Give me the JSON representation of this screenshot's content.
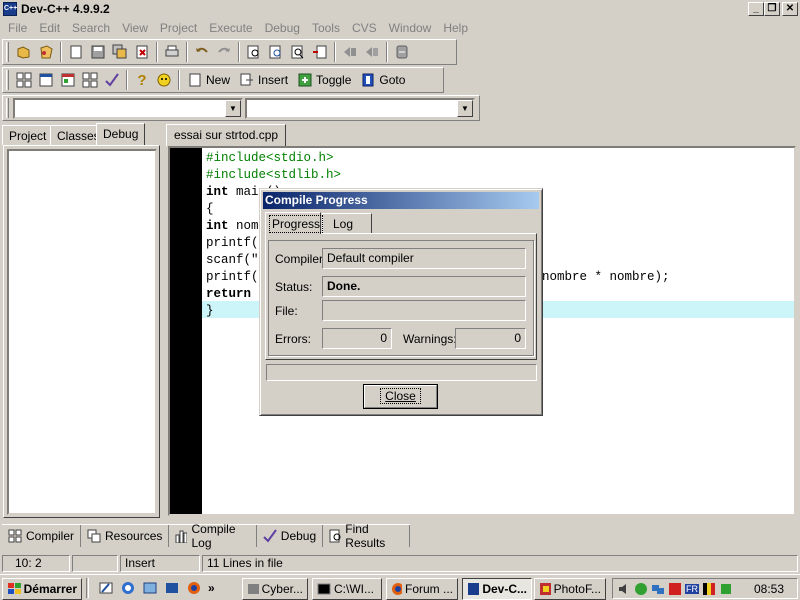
{
  "window": {
    "title": "Dev-C++ 4.9.9.2",
    "minimize": "_",
    "restore": "❐",
    "close": "✕"
  },
  "menu": [
    "File",
    "Edit",
    "Search",
    "View",
    "Project",
    "Execute",
    "Debug",
    "Tools",
    "CVS",
    "Window",
    "Help"
  ],
  "toolbar2": {
    "new": "New",
    "insert": "Insert",
    "toggle": "Toggle",
    "goto": "Goto"
  },
  "left_tabs": [
    "Project",
    "Classes",
    "Debug"
  ],
  "editor_tab": "essai sur strtod.cpp",
  "code_lines": [
    {
      "text": "#include<stdio.h>",
      "color": "#008000",
      "bold": false
    },
    {
      "text": "#include<stdlib.h>",
      "color": "#008000",
      "bold": false
    },
    {
      "text": "int main()",
      "color": "#000000",
      "bold": false
    },
    {
      "text": "{",
      "color": "#000000",
      "bold": false
    },
    {
      "text": "int nom",
      "color": "#000000",
      "bold": false
    },
    {
      "text": "printf(",
      "color": "#000000",
      "bold": false
    },
    {
      "text": "scanf(\"",
      "color": "#000000",
      "bold": false
    },
    {
      "text": "printf(",
      "color": "#000000",
      "bold": false
    },
    {
      "text": "return",
      "color": "#000000",
      "bold": true
    },
    {
      "text": "}",
      "color": "#000000",
      "bold": false
    }
  ],
  "code_tail": "nombre * nombre);",
  "dialog": {
    "title": "Compile Progress",
    "tabs": [
      "Progress",
      "Log"
    ],
    "compiler_label": "Compiler:",
    "compiler_value": "Default compiler",
    "status_label": "Status:",
    "status_value": "Done.",
    "file_label": "File:",
    "file_value": "",
    "errors_label": "Errors:",
    "errors_value": "0",
    "warnings_label": "Warnings:",
    "warnings_value": "0",
    "close_button": "Close"
  },
  "bottom_tabs": [
    "Compiler",
    "Resources",
    "Compile Log",
    "Debug",
    "Find Results"
  ],
  "status": {
    "position": "10: 2",
    "mode": "Insert",
    "lines": "11 Lines in file"
  },
  "taskbar": {
    "start": "Démarrer",
    "quick_more": "»",
    "tasks": [
      "Cyber...",
      "C:\\WI...",
      "Forum ...",
      "Dev-C...",
      "PhotoF..."
    ],
    "clock": "08:53",
    "lang": "FR"
  }
}
